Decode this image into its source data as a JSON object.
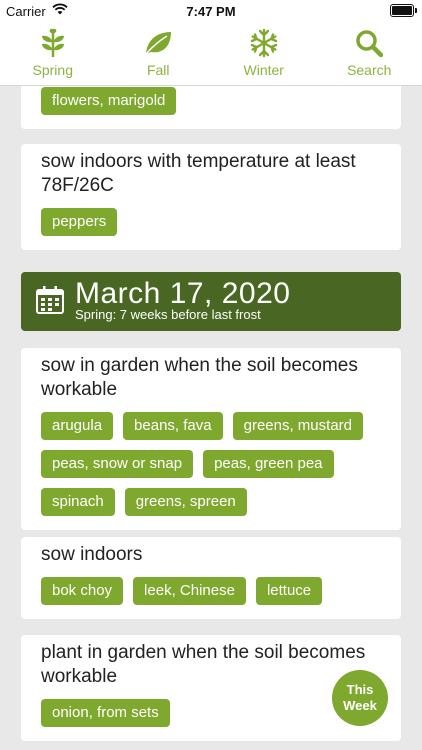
{
  "status": {
    "carrier": "Carrier",
    "time": "7:47 PM"
  },
  "tabs": [
    {
      "label": "Spring",
      "icon": "leaf-branch-icon"
    },
    {
      "label": "Fall",
      "icon": "leaf-icon"
    },
    {
      "label": "Winter",
      "icon": "snowflake-icon"
    },
    {
      "label": "Search",
      "icon": "search-icon"
    }
  ],
  "cards": [
    {
      "title": "",
      "tags": [
        "flowers, marigold"
      ]
    },
    {
      "title": "sow indoors with temperature at least 78F/26C",
      "tags": [
        "peppers"
      ]
    },
    {
      "title": "sow in garden when the soil becomes workable",
      "tags": [
        "arugula",
        "beans, fava",
        "greens, mustard",
        "peas, snow or snap",
        "peas, green pea",
        "spinach",
        "greens, spreen"
      ]
    },
    {
      "title": "sow indoors",
      "tags": [
        "bok choy",
        "leek, Chinese",
        "lettuce"
      ]
    },
    {
      "title": "plant in garden when the soil becomes workable",
      "tags": [
        "onion, from sets"
      ]
    }
  ],
  "date_header": {
    "date": "March 17, 2020",
    "subtitle": "Spring: 7 weeks before last frost"
  },
  "this_week": {
    "line1": "This",
    "line2": "Week"
  },
  "colors": {
    "accent": "#7fa82f",
    "header_dark": "#4a6623",
    "background": "#e8e8e8"
  }
}
